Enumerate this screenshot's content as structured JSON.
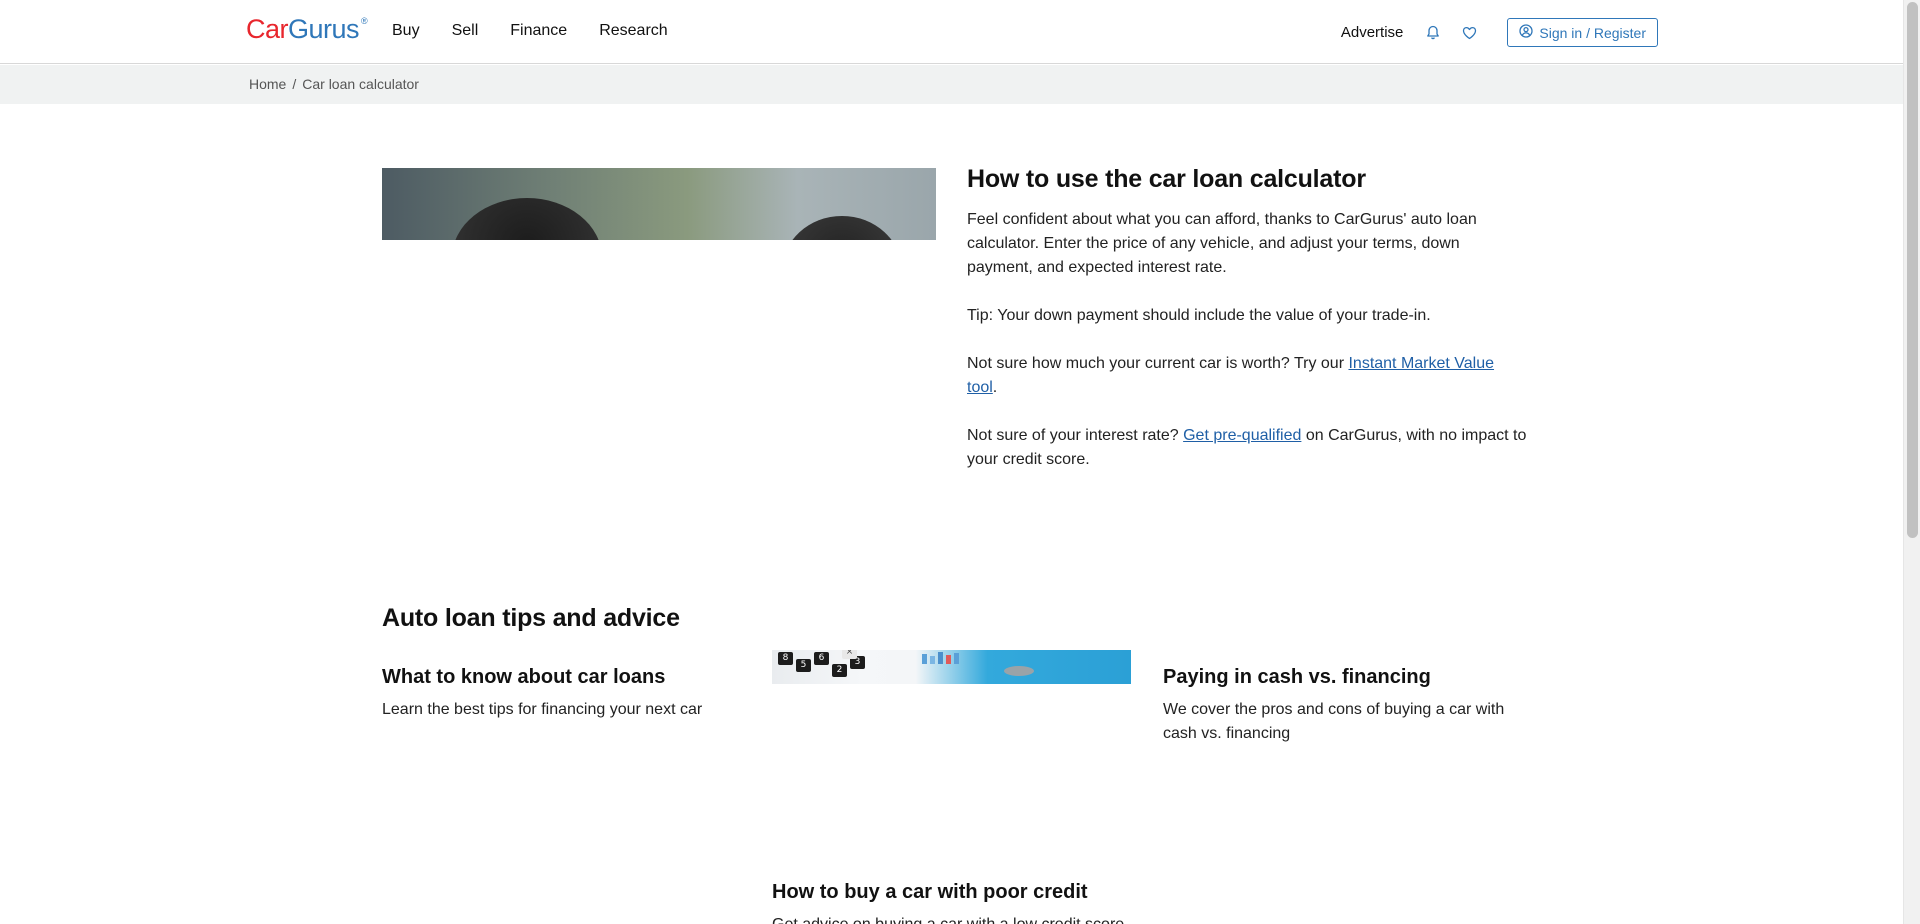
{
  "header": {
    "logo_car": "Car",
    "logo_gurus": "Gurus",
    "logo_reg": "®",
    "nav": [
      "Buy",
      "Sell",
      "Finance",
      "Research"
    ],
    "advertise": "Advertise",
    "signin": "Sign in / Register",
    "icons": [
      "bell-icon",
      "heart-icon",
      "user-circle-icon"
    ]
  },
  "breadcrumb": {
    "home": "Home",
    "separator": "/",
    "current": "Car loan calculator"
  },
  "hero": {
    "title": "How to use the car loan calculator",
    "p1": "Feel confident about what you can afford, thanks to CarGurus' auto loan calculator. Enter the price of any vehicle, and adjust your terms, down payment, and expected interest rate.",
    "p2": "Tip: Your down payment should include the value of your trade-in.",
    "p3_pre": "Not sure how much your current car is worth? Try our ",
    "p3_link": "Instant Market Value tool",
    "p3_post": ".",
    "p4_pre": "Not sure of your interest rate? ",
    "p4_link": "Get pre-qualified",
    "p4_post": " on CarGurus, with no impact to your credit score."
  },
  "tips": {
    "title": "Auto loan tips and advice",
    "cards": [
      {
        "title": "What to know about car loans",
        "desc": "Learn the best tips for financing your next car"
      },
      {
        "title": "Paying in cash vs. financing",
        "desc": "We cover the pros and cons of buying a car with cash vs. financing"
      },
      {
        "title": "How to buy a car with poor credit",
        "desc": "Get advice on buying a car with a low credit score"
      }
    ],
    "calc_keys": [
      "8",
      "5",
      "6",
      "2",
      "3",
      "×"
    ]
  },
  "colors": {
    "brand_red": "#e8262d",
    "brand_blue": "#2f77b9",
    "link_blue": "#1f5fa6"
  }
}
